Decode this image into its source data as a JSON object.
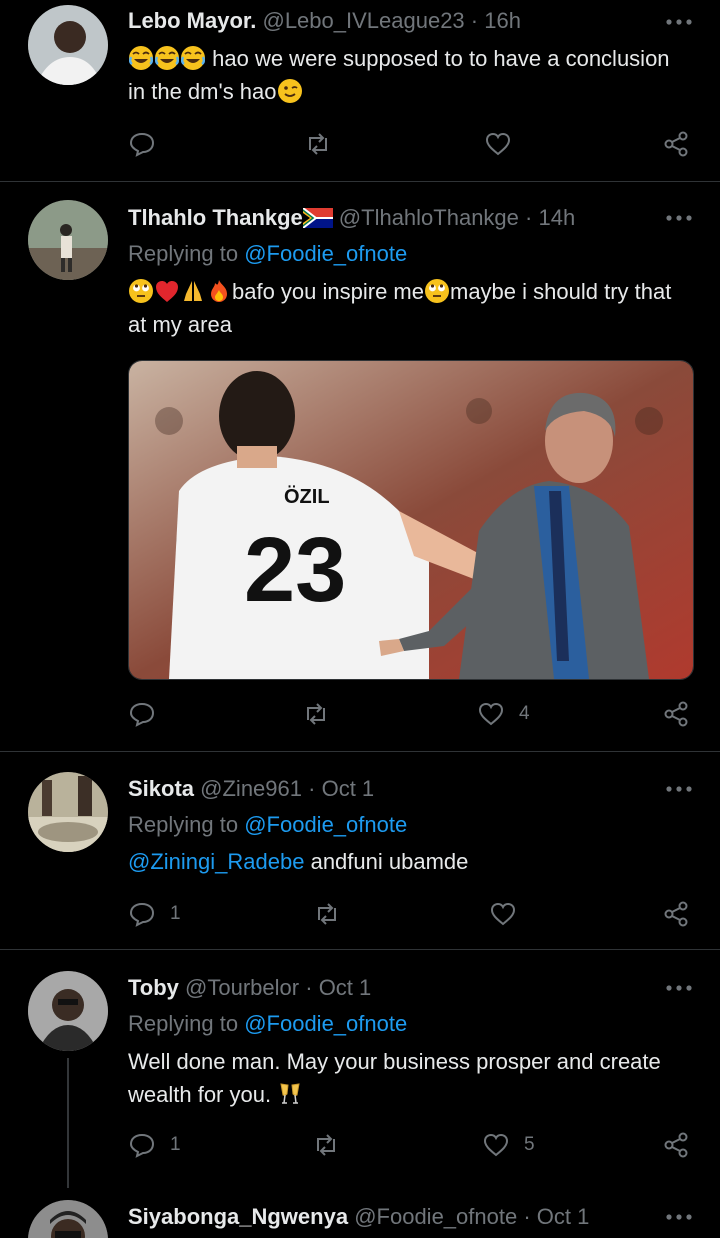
{
  "tweets": [
    {
      "name": "Lebo Mayor.",
      "handle": "@Lebo_IVLeague23",
      "time": "16h",
      "text_after_emojis": "hao we were supposed to to have a conclusion in the dm's hao",
      "emoji_prefix": [
        "face-with-tears-of-joy",
        "face-with-tears-of-joy",
        "face-with-tears-of-joy"
      ],
      "emoji_suffix": [
        "winking-face"
      ],
      "reply_count": "",
      "like_count": ""
    },
    {
      "name": "Tlhahlo Thankge",
      "flag": "south-africa-flag",
      "handle": "@TlhahloThankge",
      "time": "14h",
      "replying_to_label": "Replying to",
      "replying_to": "@Foodie_ofnote",
      "text_part1": "bafo you inspire me",
      "text_part2": "maybe i should try that at my area",
      "media": {
        "jersey_name": "ÖZIL",
        "jersey_number": "23"
      },
      "reply_count": "",
      "like_count": "4"
    },
    {
      "name": "Sikota",
      "handle": "@Zine961",
      "time": "Oct 1",
      "replying_to_label": "Replying to",
      "replying_to": "@Foodie_ofnote",
      "mention": "@Ziningi_Radebe",
      "text": "andfuni ubamde",
      "reply_count": "1",
      "like_count": ""
    },
    {
      "name": "Toby",
      "handle": "@Tourbelor",
      "time": "Oct 1",
      "replying_to_label": "Replying to",
      "replying_to": "@Foodie_ofnote",
      "text": "Well done man. May your business prosper and create wealth for you.",
      "reply_count": "1",
      "like_count": "5"
    },
    {
      "name": "Siyabonga_Ngwenya",
      "handle": "@Foodie_ofnote",
      "time": "Oct 1"
    }
  ],
  "separator": "·",
  "colors": {
    "background": "#000000",
    "text": "#e7e9ea",
    "muted": "#71767b",
    "link": "#1d9bf0",
    "divider": "#2f3336"
  }
}
